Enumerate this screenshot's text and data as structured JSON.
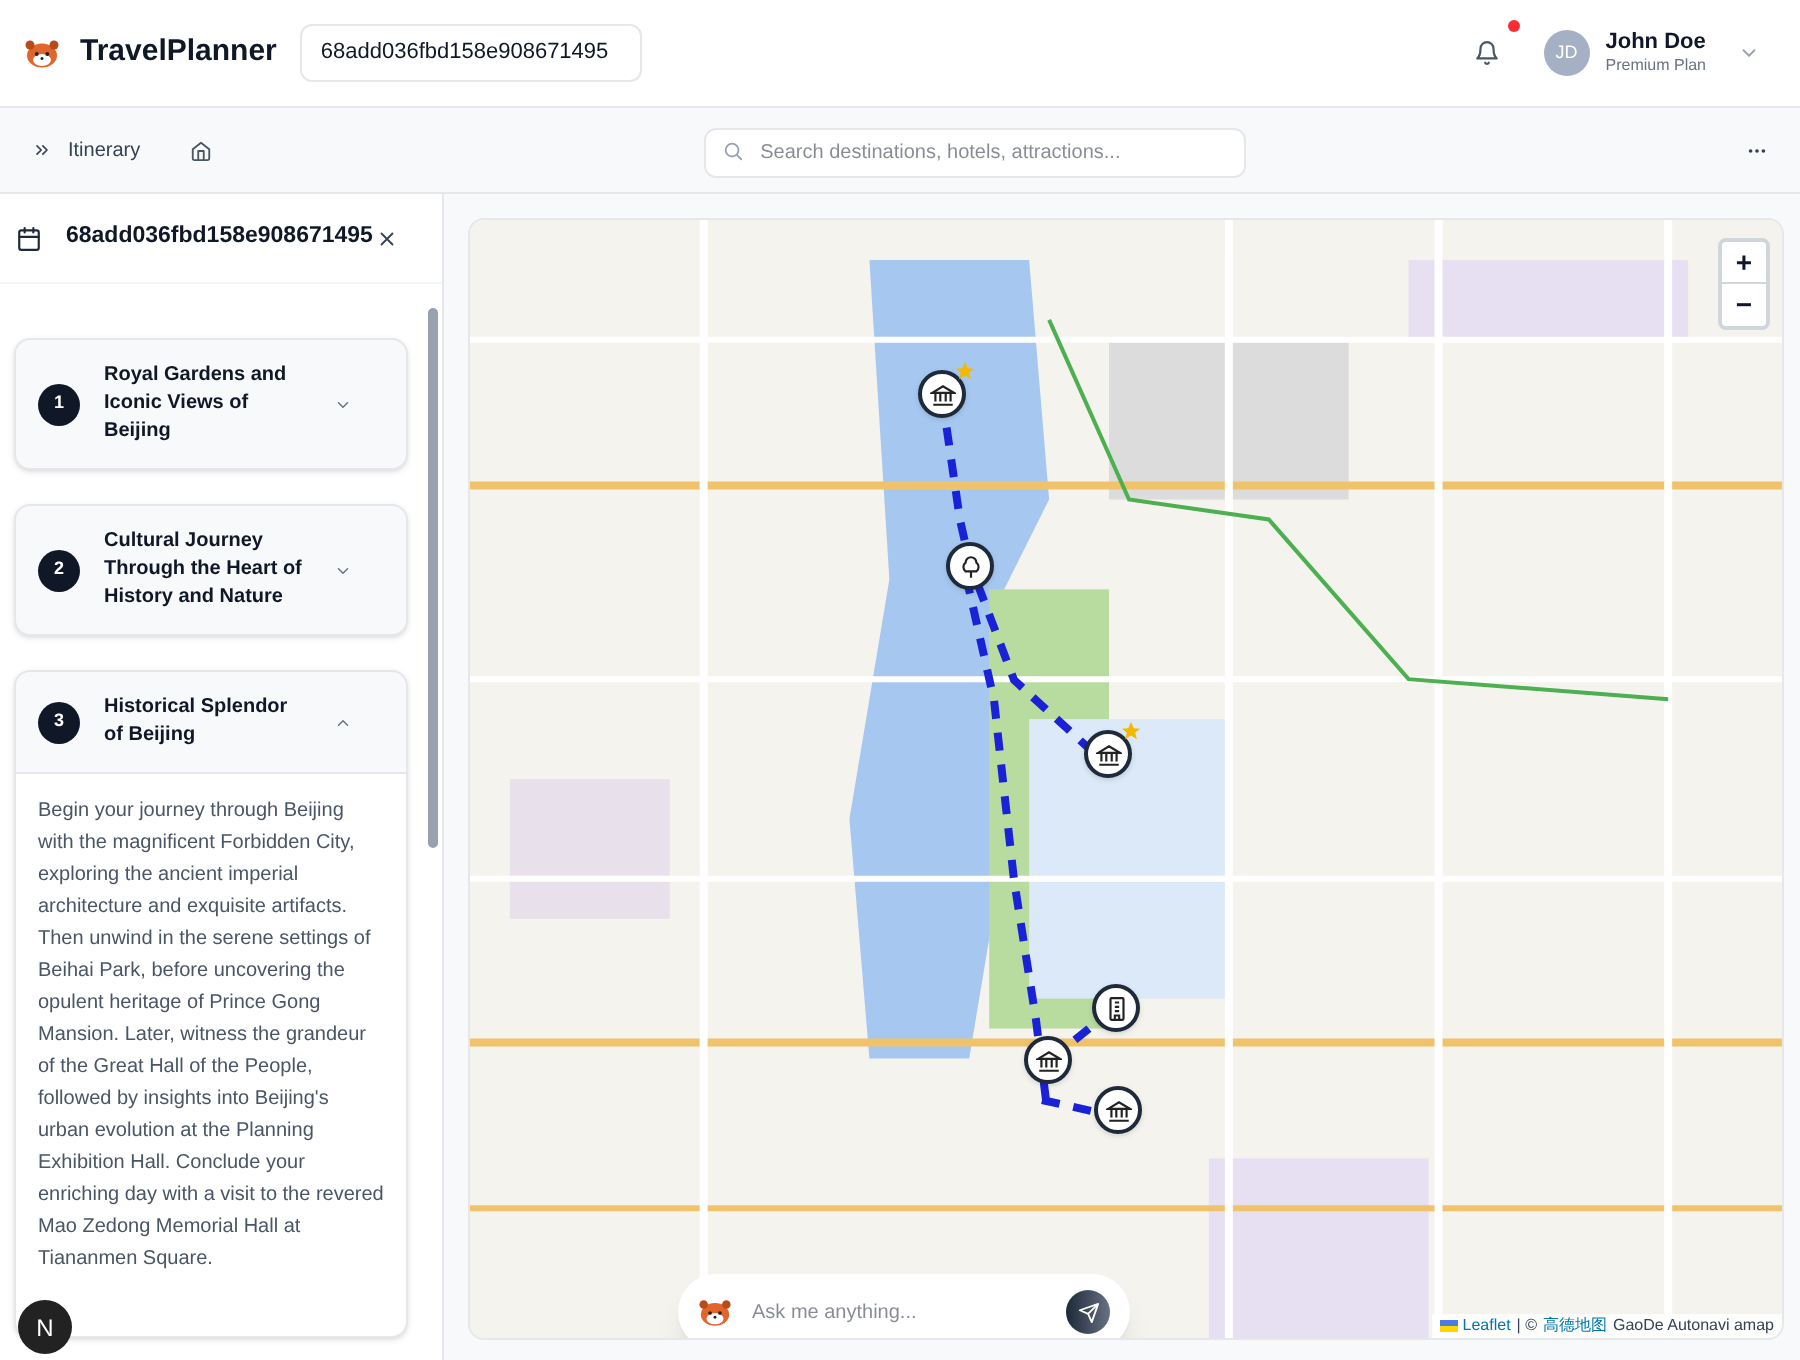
{
  "header": {
    "app_name": "TravelPlanner",
    "trip_id": "68add036fbd158e908671495",
    "notifications_unread": true,
    "user": {
      "initials": "JD",
      "name": "John Doe",
      "plan": "Premium Plan"
    }
  },
  "toolbar": {
    "itinerary_label": "Itinerary",
    "search": {
      "placeholder": "Search destinations, hotels, attractions..."
    }
  },
  "sidebar": {
    "title": "68add036fbd158e908671495",
    "days": [
      {
        "number": "1",
        "title": "Royal Gardens and Iconic Views of Beijing",
        "expanded": false
      },
      {
        "number": "2",
        "title": "Cultural Journey Through the Heart of History and Nature",
        "expanded": false
      },
      {
        "number": "3",
        "title": "Historical Splendor of Beijing",
        "expanded": true,
        "description": "Begin your journey through Beijing with the magnificent Forbidden City, exploring the ancient imperial architecture and exquisite artifacts. Then unwind in the serene settings of Beihai Park, before uncovering the opulent heritage of Prince Gong Mansion. Later, witness the grandeur of the Great Hall of the People, followed by insights into Beijing's urban evolution at the Planning Exhibition Hall. Conclude your enriching day with a visit to the revered Mao Zedong Memorial Hall at Tiananmen Square."
      }
    ]
  },
  "map": {
    "markers": [
      {
        "kind": "museum",
        "featured": true
      },
      {
        "kind": "park",
        "featured": false
      },
      {
        "kind": "museum",
        "featured": true
      },
      {
        "kind": "building",
        "featured": false
      },
      {
        "kind": "museum",
        "featured": false
      },
      {
        "kind": "museum",
        "featured": false
      }
    ],
    "zoom_in": "+",
    "zoom_out": "−",
    "attribution": {
      "leaflet": "Leaflet",
      "separator": "| ©",
      "provider": "高德地图",
      "suffix": "GaoDe Autonavi amap"
    }
  },
  "chat": {
    "placeholder": "Ask me anything..."
  },
  "dev_badge": "N"
}
